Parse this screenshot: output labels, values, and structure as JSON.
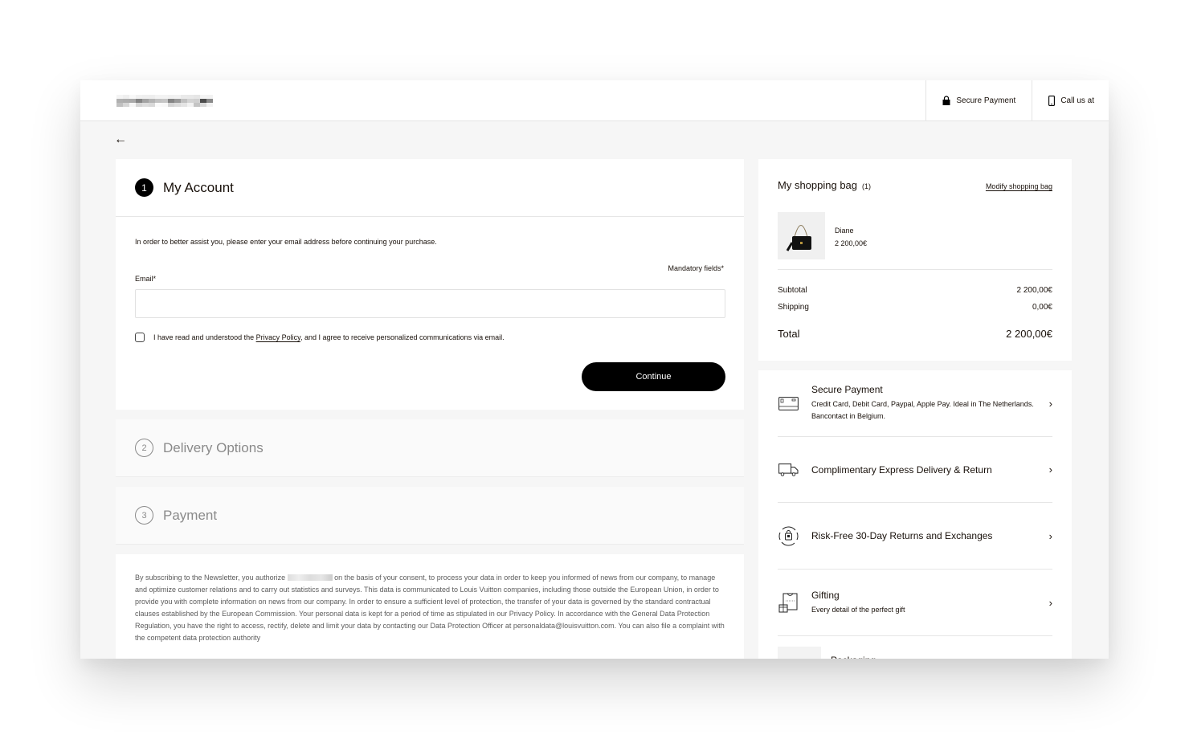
{
  "header": {
    "logo_alt": "Brand logo (pixelated)",
    "secure_payment_label": "Secure Payment",
    "call_us_label": "Call us at"
  },
  "nav": {
    "back_icon": "arrow-left-icon"
  },
  "checkout": {
    "account": {
      "step_number": "1",
      "title": "My Account",
      "intro": "In order to better assist you, please enter your email address before continuing your purchase.",
      "mandatory_note": "Mandatory fields*",
      "email_label": "Email*",
      "email_value": "",
      "email_placeholder": "",
      "consent_prefix": "I have read and understood the ",
      "consent_link": "Privacy Policy",
      "consent_suffix": ", and I agree to receive personalized communications via email.",
      "consent_checked": false,
      "continue_label": "Continue"
    },
    "steps": [
      {
        "number": "2",
        "title": "Delivery Options"
      },
      {
        "number": "3",
        "title": "Payment"
      }
    ],
    "legal": {
      "part1": "By subscribing to the Newsletter, you authorize ",
      "part2": " on the basis of your consent, to process your data in order to keep you informed of news from our company, to manage and optimize customer relations and to carry out statistics and surveys. This data is communicated to Louis Vuitton companies, including those outside the European Union, in order to provide you with complete information on news from our company. In order to ensure a sufficient level of protection, the transfer of your data is governed by the standard contractual clauses established by the European Commission. Your personal data is kept for a period of time as stipulated in our Privacy Policy. In accordance with the General Data Protection Regulation, you have the right to access, rectify, delete and limit your data by contacting our Data Protection Officer at personaldata@louisvuitton.com. You can also file a complaint with the competent data protection authority"
    }
  },
  "bag": {
    "title": "My shopping bag",
    "count": "(1)",
    "modify_label": "Modify shopping bag",
    "items": [
      {
        "name": "Diane",
        "price": "2 200,00€"
      }
    ],
    "subtotal_label": "Subtotal",
    "subtotal_value": "2 200,00€",
    "shipping_label": "Shipping",
    "shipping_value": "0,00€",
    "total_label": "Total",
    "total_value": "2 200,00€"
  },
  "services": [
    {
      "icon": "credit-card-icon",
      "title": "Secure Payment",
      "desc": "Credit Card, Debit Card, Paypal, Apple Pay. Ideal in The Netherlands. Bancontact in Belgium."
    },
    {
      "icon": "delivery-truck-icon",
      "title": "Complimentary Express Delivery & Return",
      "desc": ""
    },
    {
      "icon": "returns-icon",
      "title": "Risk-Free 30-Day Returns and Exchanges",
      "desc": ""
    },
    {
      "icon": "gift-icon",
      "title": "Gifting",
      "desc": "Every detail of the perfect gift"
    },
    {
      "icon": "packaging-thumbnail",
      "title": "Packaging",
      "desc": ""
    }
  ]
}
